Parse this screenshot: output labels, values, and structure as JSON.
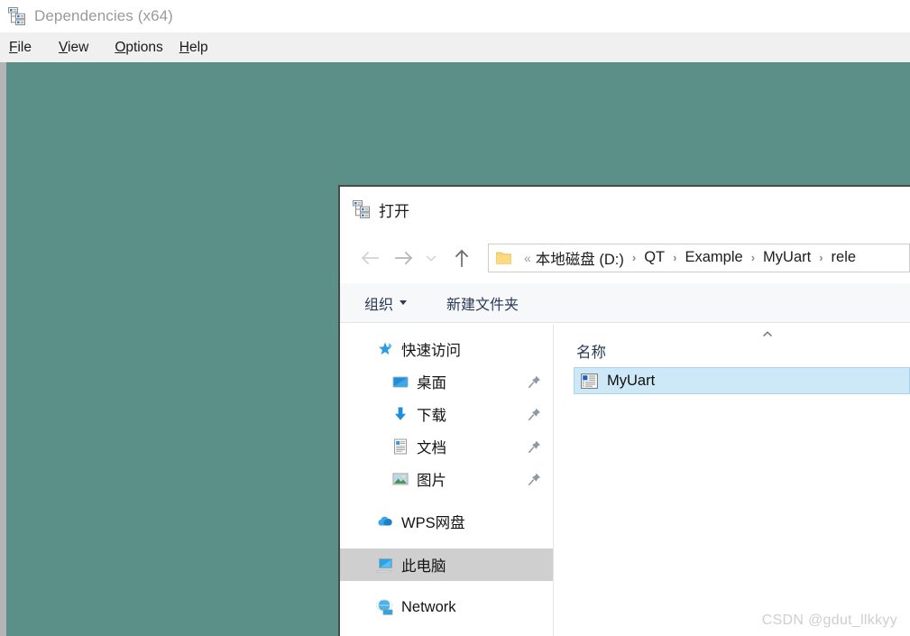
{
  "app": {
    "title": "Dependencies (x64)",
    "title_icon": "dependencies-tree-icon",
    "menu": [
      {
        "name": "file",
        "mnemonic": "F",
        "rest": "ile"
      },
      {
        "name": "view",
        "mnemonic": "V",
        "rest": "iew"
      },
      {
        "name": "options",
        "mnemonic": "O",
        "rest": "ptions"
      },
      {
        "name": "help",
        "mnemonic": "H",
        "rest": "elp"
      }
    ],
    "client_background": "#5b9089"
  },
  "dialog": {
    "title": "打开",
    "title_icon": "dependencies-tree-icon",
    "nav": {
      "back_icon": "arrow-left-icon",
      "forward_icon": "arrow-right-icon",
      "recent_icon": "chevron-down-icon",
      "up_icon": "arrow-up-icon"
    },
    "address": {
      "folder_icon": "folder-icon",
      "overflow": "«",
      "crumbs": [
        {
          "label": "本地磁盘 (D:)"
        },
        {
          "label": "QT"
        },
        {
          "label": "Example"
        },
        {
          "label": "MyUart"
        },
        {
          "label": "rele"
        }
      ],
      "separator": "›"
    },
    "toolbar": {
      "organize_label": "组织",
      "organize_icon": "caret-down-icon",
      "new_folder_label": "新建文件夹"
    },
    "sidebar": {
      "items": [
        {
          "label": "快速访问",
          "icon": "pin-star-icon",
          "level": 0,
          "pinned": false,
          "selected": false
        },
        {
          "label": "桌面",
          "icon": "desktop-icon",
          "level": 1,
          "pinned": true,
          "selected": false
        },
        {
          "label": "下载",
          "icon": "download-icon",
          "level": 1,
          "pinned": true,
          "selected": false
        },
        {
          "label": "文档",
          "icon": "document-icon",
          "level": 1,
          "pinned": true,
          "selected": false
        },
        {
          "label": "图片",
          "icon": "pictures-icon",
          "level": 1,
          "pinned": true,
          "selected": false
        },
        {
          "label": "WPS网盘",
          "icon": "cloud-icon",
          "level": 0,
          "pinned": false,
          "selected": false
        },
        {
          "label": "此电脑",
          "icon": "this-pc-icon",
          "level": 0,
          "pinned": false,
          "selected": true
        },
        {
          "label": "Network",
          "icon": "network-icon",
          "level": 0,
          "pinned": false,
          "selected": false
        }
      ],
      "selected_background": "#cfcfcf"
    },
    "filepane": {
      "column_header": "名称",
      "sort_indicator_icon": "sort-ascending-icon",
      "rows": [
        {
          "label": "MyUart",
          "icon": "application-window-icon",
          "selected": true
        }
      ],
      "selected_background": "#cde8f7"
    }
  },
  "watermark": {
    "text": "CSDN @gdut_llkkyy"
  }
}
